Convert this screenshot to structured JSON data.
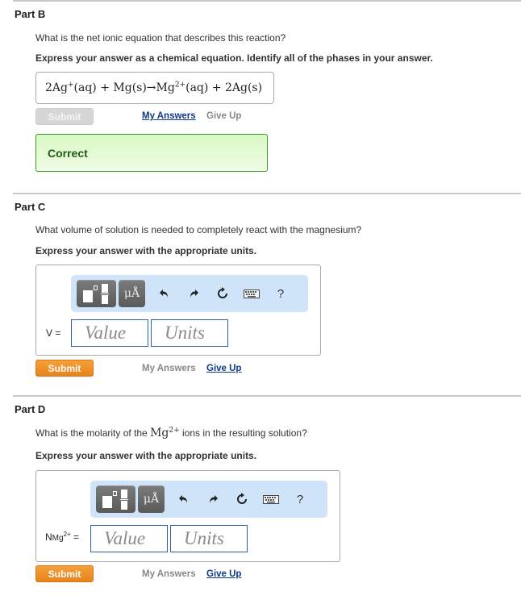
{
  "partB": {
    "title": "Part B",
    "question": "What is the net ionic equation that describes this reaction?",
    "instruction": "Express your answer as a chemical equation. Identify all of the phases in your answer.",
    "answer": {
      "t1": "2Ag",
      "s1": "+",
      "t2": "(aq) + Mg(s)→Mg",
      "s2": "2+",
      "t3": "(aq) + 2Ag(s)"
    },
    "submit_label": "Submit",
    "my_answers_label": "My Answers",
    "give_up_label": "Give Up",
    "feedback": "Correct"
  },
  "partC": {
    "title": "Part C",
    "question": "What volume of solution is needed to completely react with the magnesium?",
    "instruction": "Express your answer with the appropriate units.",
    "toolbar": {
      "templates_icon": "templates-icon",
      "units_label": "μÅ",
      "undo_icon": "undo-icon",
      "redo_icon": "redo-icon",
      "reset_icon": "reset-icon",
      "keyboard_icon": "keyboard-icon",
      "help_label": "?"
    },
    "variable_label": "V =",
    "value_placeholder": "Value",
    "units_placeholder": "Units",
    "submit_label": "Submit",
    "my_answers_label": "My Answers",
    "give_up_label": "Give Up"
  },
  "partD": {
    "title": "Part D",
    "question_pre": "What is the molarity of the ",
    "question_species": "Mg",
    "question_charge": "2+",
    "question_post": " ions in the resulting solution?",
    "instruction": "Express your answer with the appropriate units.",
    "toolbar": {
      "templates_icon": "templates-icon",
      "units_label": "μÅ",
      "undo_icon": "undo-icon",
      "redo_icon": "redo-icon",
      "reset_icon": "reset-icon",
      "keyboard_icon": "keyboard-icon",
      "help_label": "?"
    },
    "variable_main": "N",
    "variable_sub": "Mg",
    "variable_sup": "2+",
    "variable_eq": " =",
    "value_placeholder": "Value",
    "units_placeholder": "Units",
    "submit_label": "Submit",
    "my_answers_label": "My Answers",
    "give_up_label": "Give Up"
  },
  "colors": {
    "submit_active": "#e8831c",
    "submit_disabled": "#d6d6d6",
    "link_blue": "#0f3a8a",
    "correct_border": "#3a9a2a",
    "correct_bg": "#d9f7c4",
    "toolbar_bg": "#cfe3f9",
    "field_border": "#2e5fa8"
  }
}
